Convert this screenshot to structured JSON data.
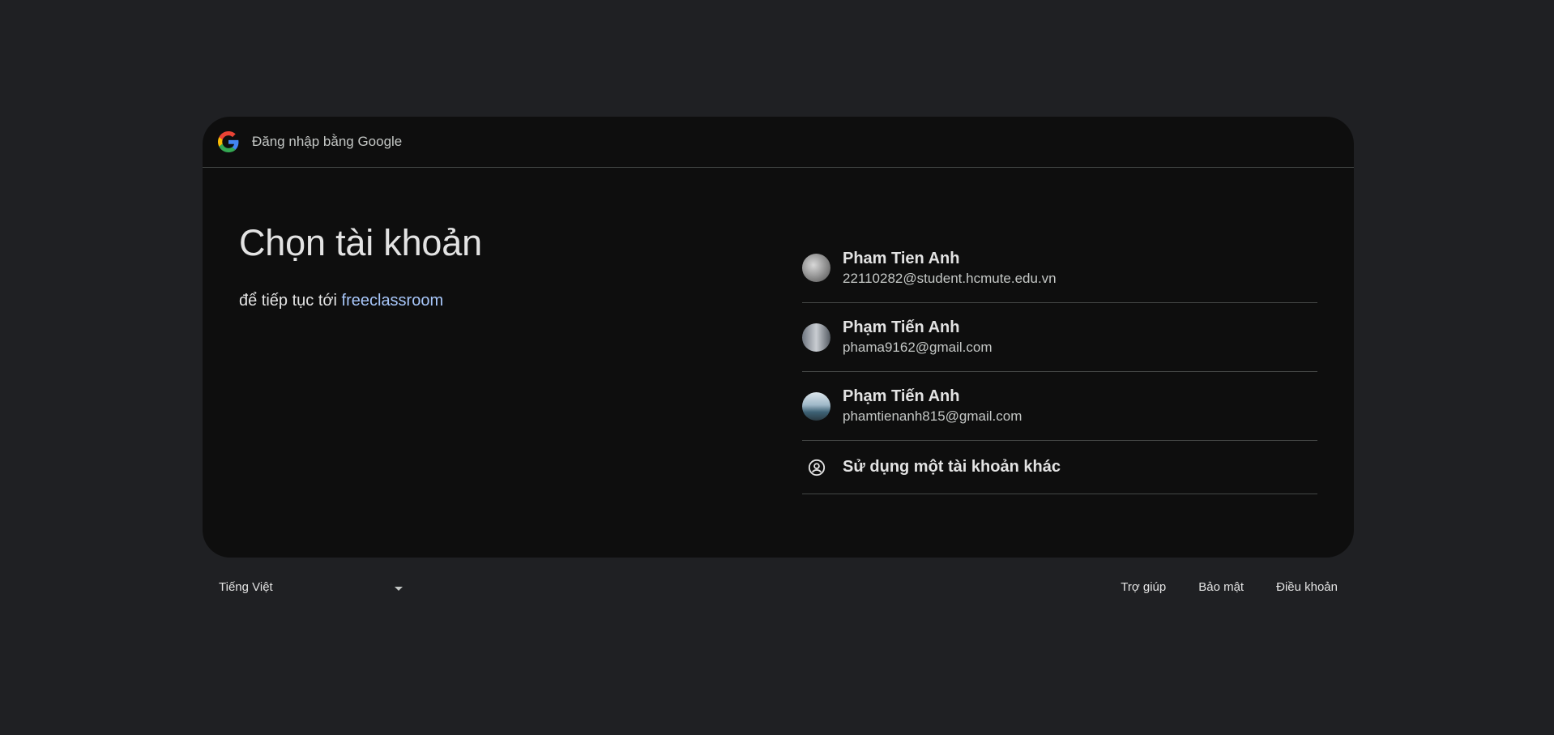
{
  "header": {
    "title": "Đăng nhập bằng Google"
  },
  "main": {
    "title": "Chọn tài khoản",
    "subtitle_prefix": "để tiếp tục tới",
    "app_name": "freeclassroom"
  },
  "accounts": [
    {
      "name": "Pham Tien Anh",
      "email": "22110282@student.hcmute.edu.vn"
    },
    {
      "name": "Phạm Tiến Anh",
      "email": "phama9162@gmail.com"
    },
    {
      "name": "Phạm Tiến Anh",
      "email": "phamtienanh815@gmail.com"
    }
  ],
  "other_account": {
    "label": "Sử dụng một tài khoản khác",
    "icon": "account-circle-icon"
  },
  "footer": {
    "language": "Tiếng Việt",
    "help": "Trợ giúp",
    "privacy": "Bảo mật",
    "terms": "Điều khoản"
  },
  "colors": {
    "background": "#1f2023",
    "card": "#0e0e0e",
    "link": "#a8c7fa",
    "divider": "#444746"
  }
}
